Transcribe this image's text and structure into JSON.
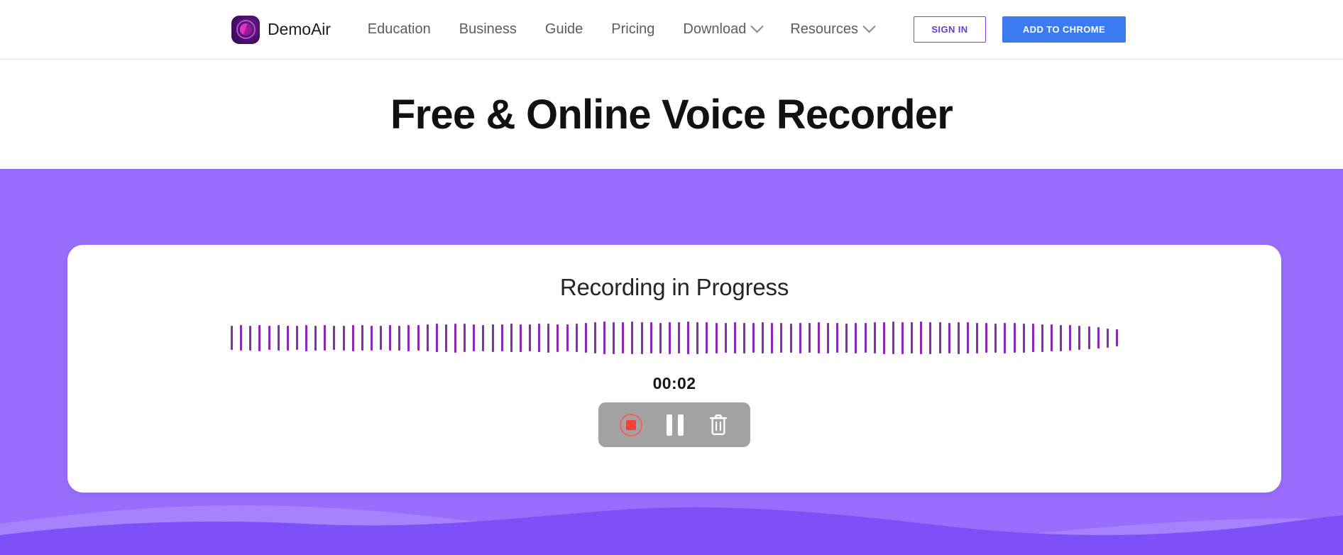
{
  "header": {
    "brand": {
      "name": "DemoAir",
      "logo_icon": "demoair-logo-icon"
    },
    "nav": [
      {
        "label": "Education",
        "has_dropdown": false
      },
      {
        "label": "Business",
        "has_dropdown": false
      },
      {
        "label": "Guide",
        "has_dropdown": false
      },
      {
        "label": "Pricing",
        "has_dropdown": false
      },
      {
        "label": "Download",
        "has_dropdown": true
      },
      {
        "label": "Resources",
        "has_dropdown": true
      }
    ],
    "sign_in_label": "SIGN IN",
    "add_to_chrome_label": "ADD TO CHROME"
  },
  "hero": {
    "title": "Free & Online Voice Recorder"
  },
  "recorder": {
    "status": "Recording in Progress",
    "timer": "00:02",
    "waveform": {
      "icon": "audio-waveform-icon",
      "bar_count": 96,
      "heights": [
        34,
        36,
        35,
        37,
        34,
        36,
        35,
        34,
        37,
        35,
        36,
        34,
        35,
        37,
        36,
        35,
        34,
        36,
        35,
        37,
        36,
        38,
        40,
        39,
        41,
        40,
        38,
        37,
        39,
        38,
        40,
        39,
        38,
        40,
        41,
        39,
        38,
        40,
        42,
        44,
        46,
        45,
        44,
        46,
        45,
        44,
        43,
        45,
        44,
        46,
        45,
        44,
        43,
        42,
        44,
        43,
        42,
        44,
        43,
        42,
        41,
        43,
        42,
        44,
        43,
        42,
        41,
        43,
        42,
        44,
        45,
        46,
        45,
        44,
        46,
        45,
        44,
        43,
        45,
        44,
        43,
        42,
        41,
        43,
        42,
        41,
        40,
        39,
        38,
        37,
        36,
        34,
        32,
        30,
        27,
        24
      ]
    },
    "controls": [
      {
        "name": "stop-record-button",
        "icon": "stop-icon",
        "label": "Stop"
      },
      {
        "name": "pause-record-button",
        "icon": "pause-icon",
        "label": "Pause"
      },
      {
        "name": "delete-record-button",
        "icon": "trash-icon",
        "label": "Delete"
      }
    ]
  },
  "theme": {
    "stage_purple": "#9a6efc",
    "wave_light": "#a683fd",
    "wave_dark": "#7e50f7",
    "accent_violet": "#7b3fe4",
    "chrome_blue": "#3a7bf2",
    "waveform_purple": "#8c29b4",
    "record_red": "#f2403c",
    "controls_gray": "#a2a2a2"
  }
}
